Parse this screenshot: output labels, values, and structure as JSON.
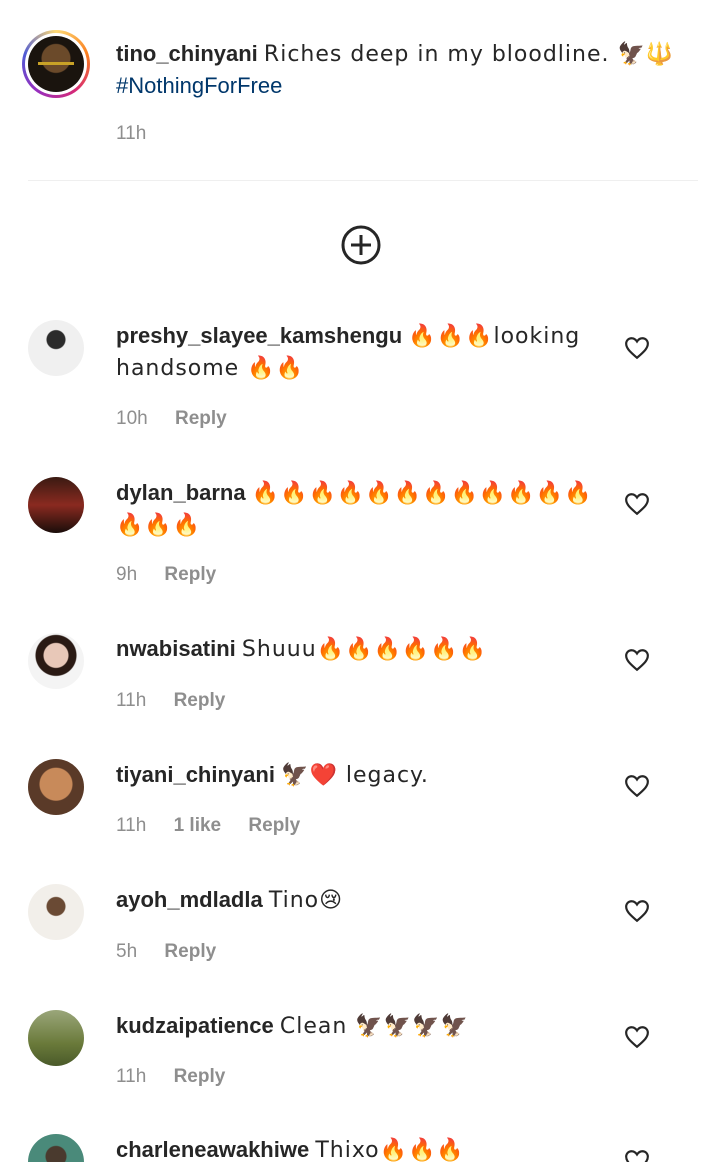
{
  "caption": {
    "username": "tino_chinyani",
    "text": "Riches deep in my bloodline. 🦅🔱",
    "hashtag": "#NothingForFree",
    "time": "11h"
  },
  "load_more_icon": "plus-circle-icon",
  "comments": [
    {
      "username": "preshy_slayee_kamshengu",
      "text": "🔥🔥🔥looking handsome 🔥🔥",
      "time": "10h",
      "likes": "",
      "reply": "Reply"
    },
    {
      "username": "dylan_barna",
      "text": "🔥🔥🔥🔥🔥🔥🔥🔥🔥🔥🔥🔥🔥🔥🔥",
      "time": "9h",
      "likes": "",
      "reply": "Reply"
    },
    {
      "username": "nwabisatini",
      "text": "Shuuu🔥🔥🔥🔥🔥🔥",
      "time": "11h",
      "likes": "",
      "reply": "Reply"
    },
    {
      "username": "tiyani_chinyani",
      "text": "🦅❤️ legacy.",
      "time": "11h",
      "likes": "1 like",
      "reply": "Reply"
    },
    {
      "username": "ayoh_mdladla",
      "text": "Tino😢",
      "time": "5h",
      "likes": "",
      "reply": "Reply"
    },
    {
      "username": "kudzaipatience",
      "text": "Clean 🦅🦅🦅🦅",
      "time": "11h",
      "likes": "",
      "reply": "Reply"
    },
    {
      "username": "charleneawakhiwe",
      "text": "Thixo🔥🔥🔥",
      "time": "",
      "likes": "",
      "reply": ""
    }
  ]
}
